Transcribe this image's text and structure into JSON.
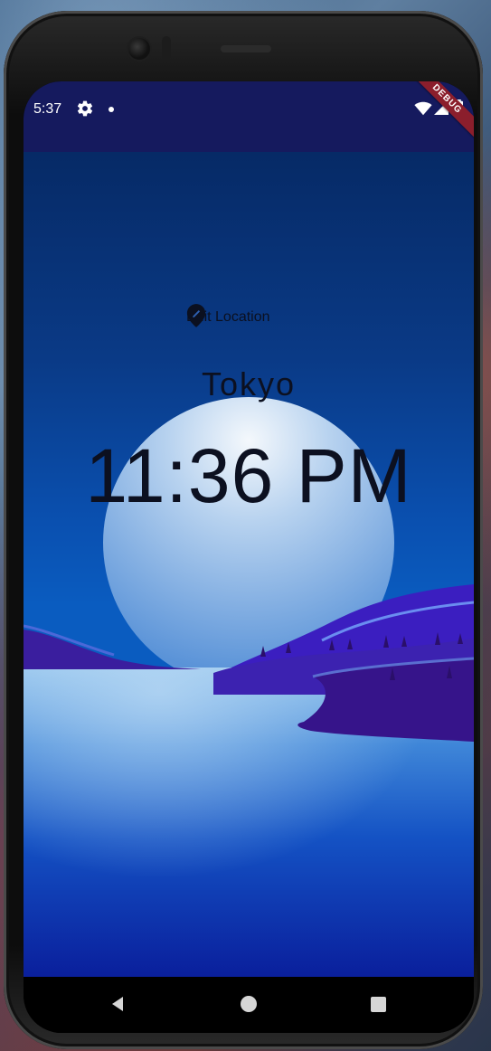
{
  "status_bar": {
    "time": "5:37",
    "icons": [
      "gear-icon",
      "notification-dot-icon",
      "wifi-icon",
      "signal-icon",
      "battery-icon"
    ]
  },
  "debug_banner": "DEBUG",
  "location_button": {
    "icon": "location-pin-icon",
    "label": "Edit Location"
  },
  "clock": {
    "city": "Tokyo",
    "time": "11:36 PM",
    "period": "night"
  },
  "nav_bar": {
    "buttons": [
      "back-icon",
      "home-icon",
      "recents-icon"
    ]
  },
  "colors": {
    "status_bar_bg": "#151a5e",
    "sky_top": "#062a66",
    "water_bottom": "#0a1f9c",
    "hills": "#3a1e9e",
    "text": "#0c1020",
    "debug_ribbon": "#8b1e2c"
  }
}
